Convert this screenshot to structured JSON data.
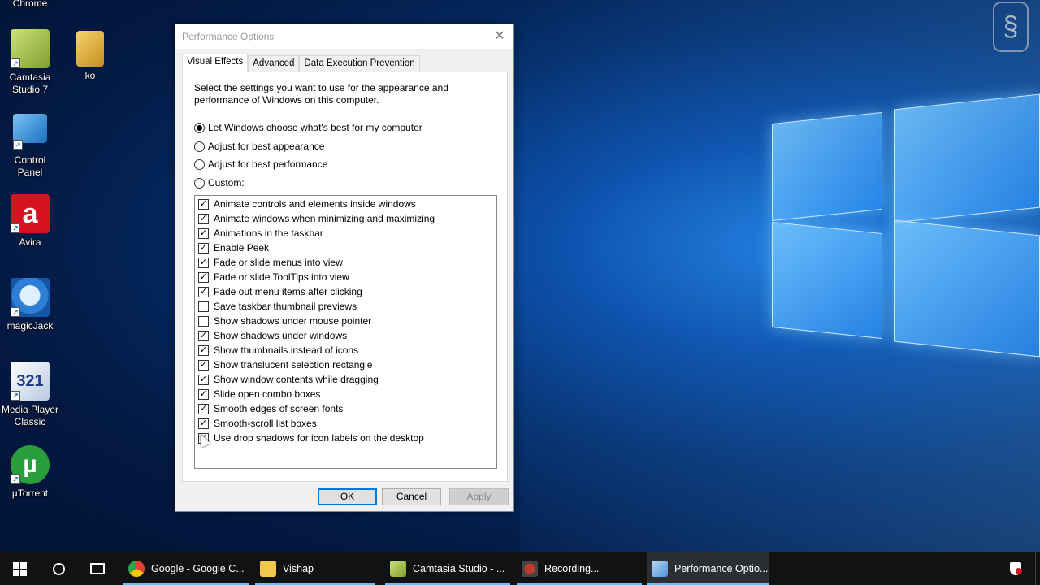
{
  "desktop": {
    "top_label": "Chrome",
    "icons": [
      {
        "label": "Camtasia\nStudio 7",
        "color": "#9ab84a"
      },
      {
        "label": "ko",
        "color": "#e0b040"
      },
      {
        "label": "Control\nPanel",
        "color": "#2b7bd0"
      },
      {
        "label": "Avira",
        "color": "#d6141f"
      },
      {
        "label": "magicJack",
        "color": "#1e6fc8"
      },
      {
        "label": "Media Player\nClassic",
        "color": "#f0f0f0"
      },
      {
        "label": "µTorrent",
        "color": "#2a9d3c"
      }
    ]
  },
  "dialog": {
    "title": "Performance Options",
    "tabs": [
      "Visual Effects",
      "Advanced",
      "Data Execution Prevention"
    ],
    "description": "Select the settings you want to use for the appearance and performance of Windows on this computer.",
    "radios": [
      {
        "label": "Let Windows choose what's best for my computer",
        "selected": true
      },
      {
        "label": "Adjust for best appearance",
        "selected": false
      },
      {
        "label": "Adjust for best performance",
        "selected": false
      },
      {
        "label": "Custom:",
        "selected": false
      }
    ],
    "options": [
      {
        "label": "Animate controls and elements inside windows",
        "checked": true
      },
      {
        "label": "Animate windows when minimizing and maximizing",
        "checked": true
      },
      {
        "label": "Animations in the taskbar",
        "checked": true
      },
      {
        "label": "Enable Peek",
        "checked": true
      },
      {
        "label": "Fade or slide menus into view",
        "checked": true
      },
      {
        "label": "Fade or slide ToolTips into view",
        "checked": true
      },
      {
        "label": "Fade out menu items after clicking",
        "checked": true
      },
      {
        "label": "Save taskbar thumbnail previews",
        "checked": false
      },
      {
        "label": "Show shadows under mouse pointer",
        "checked": false
      },
      {
        "label": "Show shadows under windows",
        "checked": true
      },
      {
        "label": "Show thumbnails instead of icons",
        "checked": true
      },
      {
        "label": "Show translucent selection rectangle",
        "checked": true
      },
      {
        "label": "Show window contents while dragging",
        "checked": true
      },
      {
        "label": "Slide open combo boxes",
        "checked": true
      },
      {
        "label": "Smooth edges of screen fonts",
        "checked": true
      },
      {
        "label": "Smooth-scroll list boxes",
        "checked": true
      },
      {
        "label": "Use drop shadows for icon labels on the desktop",
        "checked": true
      }
    ],
    "buttons": {
      "ok": "OK",
      "cancel": "Cancel",
      "apply": "Apply"
    }
  },
  "taskbar": {
    "apps": [
      {
        "label": "Google - Google C...",
        "color": "#e34133"
      },
      {
        "label": "Vishap",
        "color": "#f2c94c"
      },
      {
        "label": "Camtasia Studio - ...",
        "color": "#9ab84a"
      },
      {
        "label": "Recording...",
        "color": "#c0392b"
      },
      {
        "label": "Performance Optio...",
        "color": "#4a90d9"
      }
    ]
  }
}
